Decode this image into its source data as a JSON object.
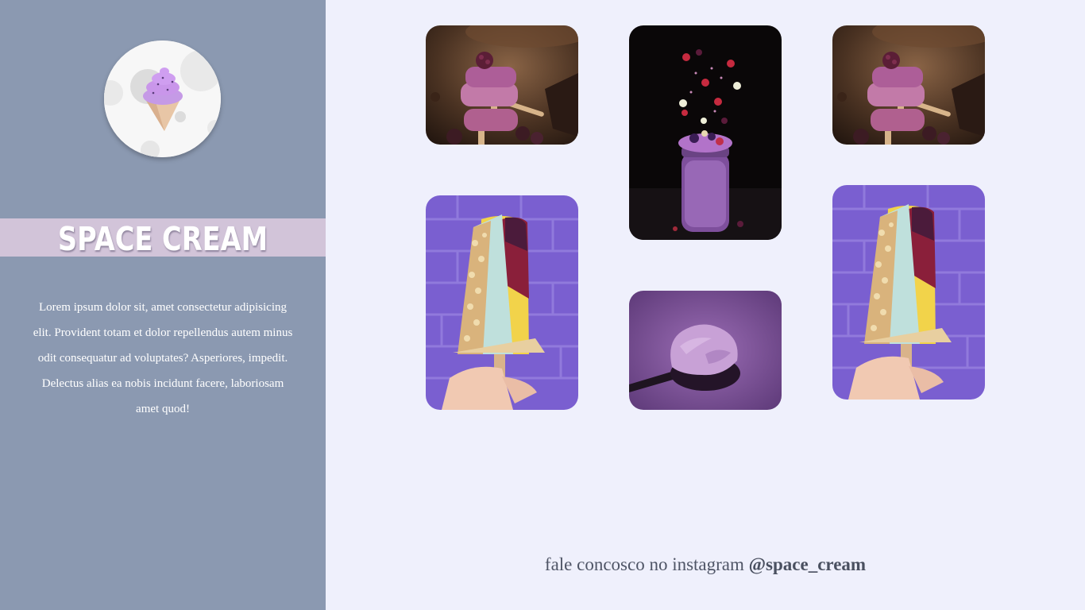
{
  "brand": {
    "title": "SPACE CREAM",
    "description": "Lorem ipsum dolor sit, amet consectetur adipisicing elit. Provident totam et dolor repellendus autem minus odit consequatur ad voluptates? Asperiores, impedit. Delectus alias ea nobis incidunt facere, laboriosam amet quod!",
    "logo_icon": "ice-cream-cone-icon"
  },
  "gallery": [
    {
      "subject": "stacked-popsicles-photo"
    },
    {
      "subject": "berry-smoothie-jar-photo"
    },
    {
      "subject": "stacked-popsicles-photo"
    },
    {
      "subject": "nut-popsicle-photo"
    },
    {
      "subject": "ice-cream-spoon-photo"
    },
    {
      "subject": "nut-popsicle-photo"
    }
  ],
  "footer": {
    "prefix": "fale concosco no instagram ",
    "handle": "@space_cream"
  },
  "colors": {
    "sidebar": "#8b99b1",
    "page_background": "#eff0fc",
    "brand_band": "#d2c4d9",
    "accent_purple": "#8b62d6"
  }
}
